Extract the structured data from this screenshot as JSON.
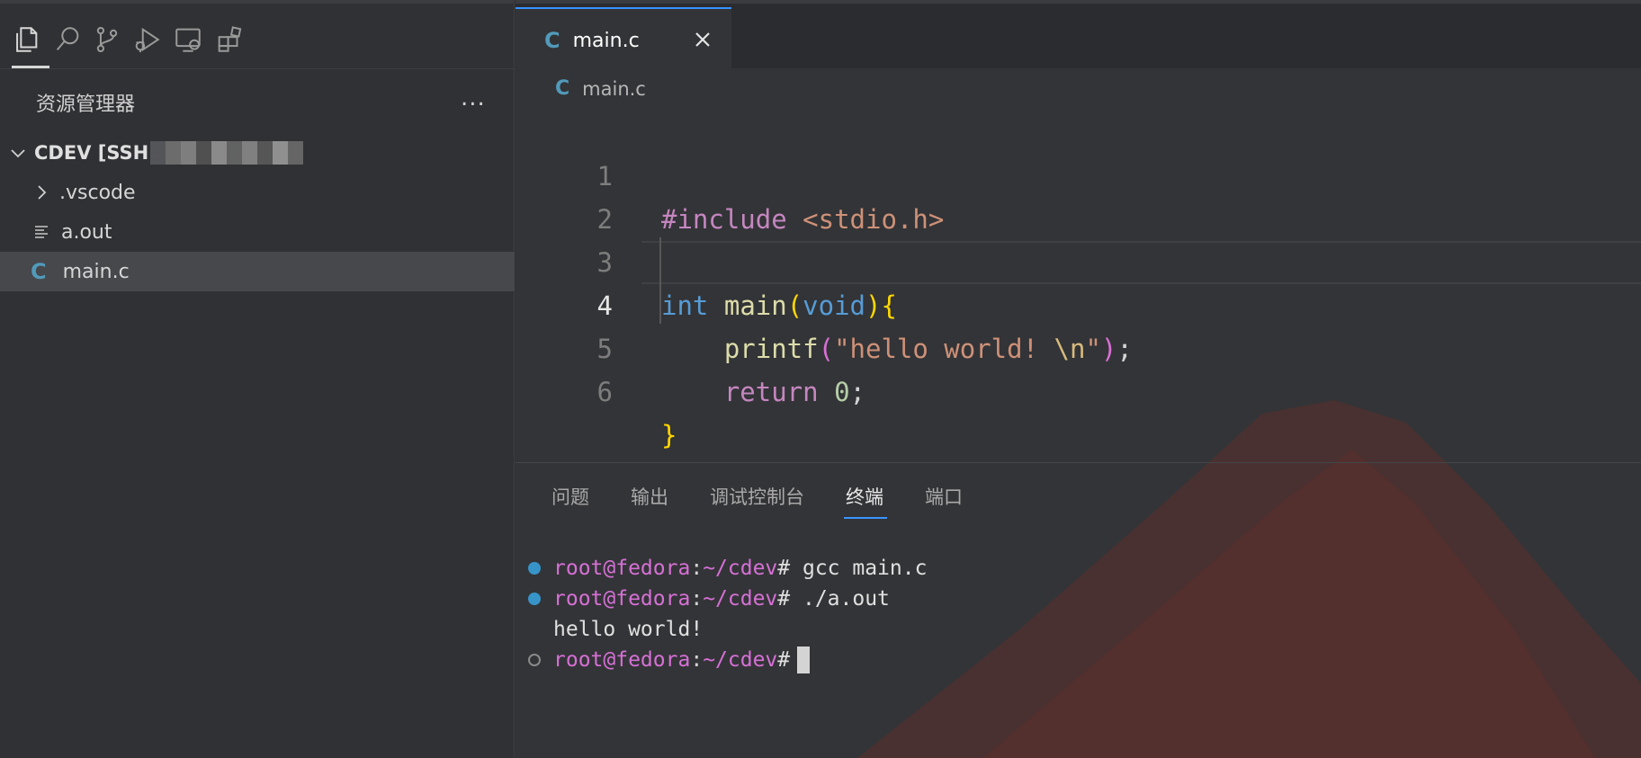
{
  "activity_bar": {
    "icons": [
      "files-icon",
      "search-icon",
      "source-control-icon",
      "run-debug-icon",
      "remote-explorer-icon",
      "extensions-icon"
    ]
  },
  "sidebar": {
    "title": "资源管理器",
    "more": "...",
    "root_folder": "CDEV [SSH",
    "items": [
      {
        "label": ".vscode",
        "type": "folder"
      },
      {
        "label": "a.out",
        "type": "file"
      },
      {
        "label": "main.c",
        "type": "c-file",
        "selected": true
      }
    ]
  },
  "editor": {
    "tab_label": "main.c",
    "tab_glyph": "C",
    "breadcrumb": "main.c",
    "breadcrumb_glyph": "C",
    "line_numbers": [
      "1",
      "2",
      "3",
      "4",
      "5",
      "6"
    ],
    "current_line": 4,
    "code": {
      "l1_pre": "#include",
      "l1_inc": "<stdio.h>",
      "l3_kw": "int",
      "l3_fn": "main",
      "l3_lp": "(",
      "l3_void": "void",
      "l3_rp": ")",
      "l3_brace": "{",
      "l4_fn": "printf",
      "l4_lp": "(",
      "l4_str": "\"hello world! ",
      "l4_esc": "\\n",
      "l4_q": "\"",
      "l4_rp": ")",
      "l4_semi": ";",
      "l5_ret": "return",
      "l5_num": "0",
      "l5_semi": ";",
      "l6_brace": "}"
    }
  },
  "panel": {
    "tabs": [
      {
        "label": "问题"
      },
      {
        "label": "输出"
      },
      {
        "label": "调试控制台"
      },
      {
        "label": "终端",
        "active": true
      },
      {
        "label": "端口"
      }
    ]
  },
  "terminal": {
    "lines": [
      {
        "user": "root@fedora",
        "path": "~/cdev",
        "cmd": "# gcc main.c"
      },
      {
        "user": "root@fedora",
        "path": "~/cdev",
        "cmd": "# ./a.out"
      },
      {
        "output": "hello world!"
      },
      {
        "user": "root@fedora",
        "path": "~/cdev",
        "cmd": "#"
      }
    ],
    "colon": ":"
  },
  "colors": {
    "accent": "#3794ff",
    "c_icon": "#519aba",
    "prompt": "#d670d6"
  }
}
